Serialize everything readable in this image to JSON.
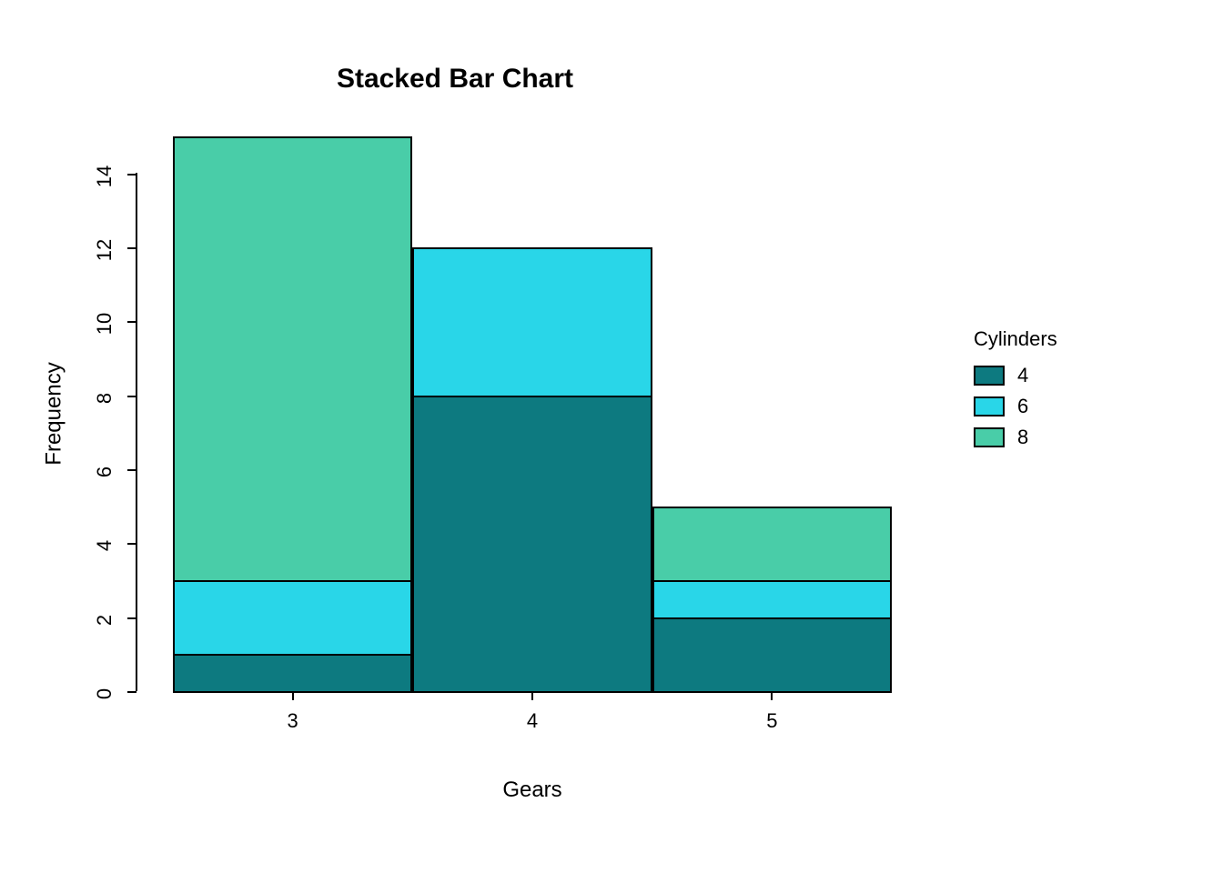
{
  "chart_data": {
    "type": "bar",
    "stacked": true,
    "title": "Stacked Bar Chart",
    "xlabel": "Gears",
    "ylabel": "Frequency",
    "categories": [
      "3",
      "4",
      "5"
    ],
    "series": [
      {
        "name": "4",
        "values": [
          1,
          8,
          2
        ],
        "color": "#0d7a80"
      },
      {
        "name": "6",
        "values": [
          2,
          4,
          1
        ],
        "color": "#29d6e8"
      },
      {
        "name": "8",
        "values": [
          12,
          0,
          2
        ],
        "color": "#49cda8"
      }
    ],
    "y_ticks": [
      0,
      2,
      4,
      6,
      8,
      10,
      12,
      14
    ],
    "ylim": [
      0,
      15
    ],
    "legend": {
      "title": "Cylinders",
      "entries": [
        "4",
        "6",
        "8"
      ]
    }
  }
}
